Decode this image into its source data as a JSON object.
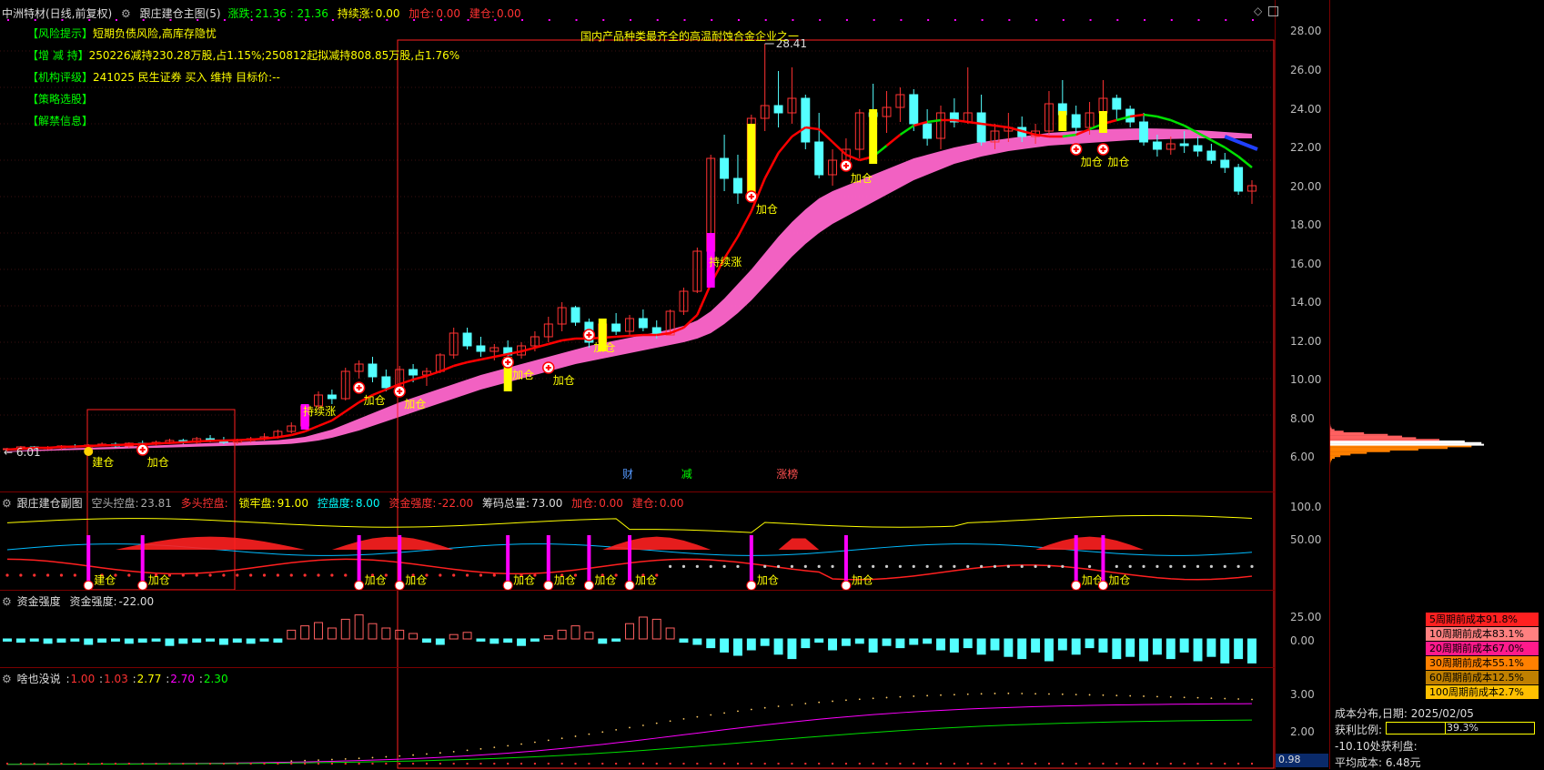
{
  "main_header": {
    "stock": "中洲特材(日线,前复权)",
    "indicator": "跟庄建仓主图(5)",
    "zd_label": "涨跌:",
    "zd_value": "21.36 : 21.36",
    "cx_label": "持续涨:",
    "cx_value": "0.00",
    "jc_label": "加仓:",
    "jc_value": "0.00",
    "jianc_label": "建仓:",
    "jianc_value": "0.00"
  },
  "info_lines": [
    {
      "key": "【风险提示】",
      "text": "短期负债风险,高库存隐忧"
    },
    {
      "key": "【增 减 持】",
      "text": "250226减持230.28万股,占1.15%;250812起拟减持808.85万股,占1.76%"
    },
    {
      "key": "【机构评级】",
      "text": "241025 民生证券 买入 维持 目标价:--"
    },
    {
      "key": "【策略选股】",
      "text": ""
    },
    {
      "key": "【解禁信息】",
      "text": ""
    }
  ],
  "banner_text": "国内产品种类最齐全的高温耐蚀合金企业之一",
  "marker_max": "28.41",
  "marker_min": "6.01",
  "event_tags": [
    "财",
    "减",
    "涨榜"
  ],
  "sub1_header": {
    "name": "跟庄建仓副图",
    "a_label": "空头控盘:",
    "a_value": "23.81",
    "b_label": "多头控盘:",
    "b_value": "",
    "c_label": "锁牢盘:",
    "c_value": "91.00",
    "d_label": "控盘度:",
    "d_value": "8.00",
    "e_label": "资金强度:",
    "e_value": "-22.00",
    "f_label": "筹码总量:",
    "f_value": "73.00",
    "g_label": "加仓:",
    "g_value": "0.00",
    "h_label": "建仓:",
    "h_value": "0.00"
  },
  "sub2_header": {
    "name": "资金强度",
    "label": "资金强度:",
    "value": "-22.00"
  },
  "sub3_header": {
    "name": "啥也没说",
    "v1": "1.00",
    "v2": "1.03",
    "v3": "2.77",
    "v4": "2.70",
    "v5": "2.30"
  },
  "axis_labels": {
    "main": [
      "28.00",
      "26.00",
      "24.00",
      "22.00",
      "20.00",
      "18.00",
      "16.00",
      "14.00",
      "12.00",
      "10.00",
      "8.00",
      "6.00"
    ],
    "sub1": [
      "100.0",
      "50.00"
    ],
    "sub2": [
      "25.00",
      "0.00"
    ],
    "sub3": [
      "3.00",
      "2.00"
    ],
    "bottom_value": "0.98"
  },
  "labels": {
    "jiacang": "加仓",
    "jiancang": "建仓",
    "chixu": "持续涨"
  },
  "cost_legend": [
    {
      "text": "5周期前成本91.8%",
      "color": "#ff2020"
    },
    {
      "text": "10周期前成本83.1%",
      "color": "#ff8080"
    },
    {
      "text": "20周期前成本67.0%",
      "color": "#ff1a8c"
    },
    {
      "text": "30周期前成本55.1%",
      "color": "#ff8000"
    },
    {
      "text": "60周期前成本12.5%",
      "color": "#c08000"
    },
    {
      "text": "100周期前成本2.7%",
      "color": "#ffc000"
    }
  ],
  "cost_info": {
    "date_label": "成本分布,日期:",
    "date": "2025/02/05",
    "profit_label": "获利比例:",
    "profit": "39.3%",
    "profit_ratio": 0.393,
    "pct_label": "-10.10处获利盘:",
    "avg_label": "平均成本:",
    "avg": "6.48元"
  },
  "colors": {
    "up": "#ff3232",
    "down": "#54ffff",
    "ma": "#ff0000",
    "ma_up": "#00e000",
    "band": "#ff66cc",
    "marker": "#ffff00"
  },
  "chart_data": {
    "type": "candlestick",
    "ylim": [
      5.0,
      29.0
    ],
    "candles": [
      [
        6.1,
        6.2,
        6.0,
        6.15
      ],
      [
        6.15,
        6.3,
        6.1,
        6.25
      ],
      [
        6.25,
        6.3,
        6.1,
        6.15
      ],
      [
        6.15,
        6.3,
        6.1,
        6.2
      ],
      [
        6.2,
        6.35,
        6.1,
        6.3
      ],
      [
        6.3,
        6.4,
        6.2,
        6.25
      ],
      [
        6.25,
        6.4,
        6.2,
        6.35
      ],
      [
        6.35,
        6.5,
        6.3,
        6.4
      ],
      [
        6.4,
        6.5,
        6.2,
        6.3
      ],
      [
        6.3,
        6.5,
        6.2,
        6.45
      ],
      [
        6.45,
        6.6,
        6.3,
        6.4
      ],
      [
        6.4,
        6.6,
        6.3,
        6.5
      ],
      [
        6.5,
        6.7,
        6.4,
        6.6
      ],
      [
        6.6,
        6.7,
        6.4,
        6.5
      ],
      [
        6.5,
        6.8,
        6.4,
        6.7
      ],
      [
        6.7,
        6.9,
        6.5,
        6.6
      ],
      [
        6.6,
        6.8,
        6.4,
        6.5
      ],
      [
        6.5,
        6.7,
        6.4,
        6.6
      ],
      [
        6.6,
        6.8,
        6.5,
        6.7
      ],
      [
        6.7,
        7.0,
        6.6,
        6.8
      ],
      [
        6.8,
        7.2,
        6.7,
        7.1
      ],
      [
        7.1,
        7.6,
        7.0,
        7.4
      ],
      [
        7.4,
        8.6,
        7.3,
        8.5
      ],
      [
        8.5,
        9.3,
        8.3,
        9.1
      ],
      [
        9.1,
        9.4,
        8.6,
        8.9
      ],
      [
        8.9,
        10.6,
        8.8,
        10.4
      ],
      [
        10.4,
        11.0,
        10.0,
        10.8
      ],
      [
        10.8,
        11.2,
        9.8,
        10.1
      ],
      [
        10.1,
        10.5,
        9.3,
        9.5
      ],
      [
        9.5,
        10.7,
        9.4,
        10.5
      ],
      [
        10.5,
        10.8,
        9.8,
        10.2
      ],
      [
        10.2,
        10.6,
        9.6,
        10.4
      ],
      [
        10.4,
        11.4,
        10.3,
        11.3
      ],
      [
        11.3,
        12.8,
        11.1,
        12.5
      ],
      [
        12.5,
        12.8,
        11.6,
        11.8
      ],
      [
        11.8,
        12.3,
        11.2,
        11.5
      ],
      [
        11.5,
        11.9,
        11.0,
        11.7
      ],
      [
        11.7,
        12.1,
        11.1,
        11.3
      ],
      [
        11.3,
        12.0,
        11.1,
        11.8
      ],
      [
        11.8,
        12.6,
        11.5,
        12.3
      ],
      [
        12.3,
        13.4,
        12.0,
        13.0
      ],
      [
        13.0,
        14.2,
        12.6,
        13.9
      ],
      [
        13.9,
        14.0,
        12.9,
        13.1
      ],
      [
        13.1,
        13.3,
        11.7,
        12.0
      ],
      [
        12.0,
        13.2,
        11.9,
        13.0
      ],
      [
        13.0,
        13.6,
        12.4,
        12.6
      ],
      [
        12.6,
        13.5,
        12.3,
        13.3
      ],
      [
        13.3,
        13.8,
        12.6,
        12.8
      ],
      [
        12.8,
        13.2,
        12.2,
        12.4
      ],
      [
        12.4,
        13.8,
        12.4,
        13.7
      ],
      [
        13.7,
        15.0,
        13.5,
        14.8
      ],
      [
        14.8,
        17.2,
        14.7,
        17.0
      ],
      [
        17.0,
        22.3,
        16.8,
        22.1
      ],
      [
        22.1,
        23.4,
        20.3,
        21.0
      ],
      [
        21.0,
        22.3,
        19.6,
        20.2
      ],
      [
        20.2,
        24.5,
        20.1,
        24.3
      ],
      [
        24.3,
        28.4,
        23.6,
        25.0
      ],
      [
        25.0,
        26.9,
        23.8,
        24.6
      ],
      [
        24.6,
        27.1,
        24.0,
        25.4
      ],
      [
        25.4,
        25.6,
        22.6,
        23.0
      ],
      [
        23.0,
        24.6,
        21.0,
        21.2
      ],
      [
        21.2,
        22.6,
        20.6,
        22.0
      ],
      [
        22.0,
        23.2,
        21.6,
        22.6
      ],
      [
        22.6,
        24.8,
        22.1,
        24.6
      ],
      [
        24.6,
        26.2,
        23.8,
        24.4
      ],
      [
        24.4,
        25.8,
        23.5,
        24.9
      ],
      [
        24.9,
        26.0,
        24.1,
        25.6
      ],
      [
        25.6,
        25.9,
        23.6,
        24.0
      ],
      [
        24.0,
        24.8,
        22.8,
        23.2
      ],
      [
        23.2,
        25.0,
        22.6,
        24.6
      ],
      [
        24.6,
        25.4,
        23.8,
        24.1
      ],
      [
        24.1,
        27.1,
        24.0,
        24.6
      ],
      [
        24.6,
        25.6,
        22.8,
        23.0
      ],
      [
        23.0,
        24.0,
        22.6,
        23.6
      ],
      [
        23.6,
        24.6,
        23.0,
        23.8
      ],
      [
        23.8,
        24.4,
        23.0,
        23.3
      ],
      [
        23.3,
        24.0,
        22.9,
        23.6
      ],
      [
        23.6,
        25.8,
        23.4,
        25.1
      ],
      [
        25.1,
        26.4,
        24.3,
        24.5
      ],
      [
        24.5,
        25.0,
        23.4,
        23.8
      ],
      [
        23.8,
        25.2,
        23.4,
        24.6
      ],
      [
        24.6,
        26.4,
        24.0,
        25.4
      ],
      [
        25.4,
        25.6,
        24.2,
        24.8
      ],
      [
        24.8,
        25.0,
        23.8,
        24.1
      ],
      [
        24.1,
        24.6,
        22.8,
        23.0
      ],
      [
        23.0,
        23.4,
        22.2,
        22.6
      ],
      [
        22.6,
        23.3,
        22.3,
        22.9
      ],
      [
        22.9,
        23.6,
        22.4,
        22.8
      ],
      [
        22.8,
        23.3,
        22.2,
        22.5
      ],
      [
        22.5,
        22.9,
        21.8,
        22.0
      ],
      [
        22.0,
        22.4,
        21.3,
        21.6
      ],
      [
        21.6,
        21.8,
        20.1,
        20.3
      ],
      [
        20.3,
        20.9,
        19.6,
        20.6
      ]
    ],
    "ma": [
      6.1,
      6.15,
      6.2,
      6.2,
      6.25,
      6.27,
      6.3,
      6.33,
      6.35,
      6.38,
      6.4,
      6.43,
      6.47,
      6.5,
      6.55,
      6.58,
      6.6,
      6.62,
      6.65,
      6.7,
      6.78,
      6.9,
      7.1,
      7.4,
      7.7,
      8.2,
      8.7,
      9.1,
      9.4,
      9.7,
      9.95,
      10.15,
      10.4,
      10.7,
      10.9,
      11.05,
      11.2,
      11.35,
      11.5,
      11.7,
      11.9,
      12.1,
      12.2,
      12.2,
      12.25,
      12.3,
      12.35,
      12.4,
      12.4,
      12.5,
      12.8,
      13.5,
      15.2,
      16.6,
      17.8,
      19.2,
      21.0,
      22.4,
      23.3,
      23.8,
      23.7,
      23.0,
      22.3,
      22.0,
      22.2,
      22.8,
      23.4,
      23.9,
      24.1,
      24.2,
      24.2,
      24.1,
      24.0,
      23.9,
      23.8,
      23.6,
      23.4,
      23.3,
      23.3,
      23.4,
      23.7,
      24.0,
      24.2,
      24.4,
      24.5,
      24.4,
      24.2,
      23.9,
      23.5,
      23.1,
      22.7,
      22.2,
      21.6
    ],
    "band_upper": [
      6.0,
      6.05,
      6.1,
      6.1,
      6.15,
      6.18,
      6.2,
      6.23,
      6.25,
      6.28,
      6.3,
      6.33,
      6.36,
      6.4,
      6.43,
      6.46,
      6.5,
      6.52,
      6.55,
      6.58,
      6.62,
      6.7,
      6.8,
      7.0,
      7.2,
      7.5,
      7.8,
      8.1,
      8.4,
      8.7,
      8.95,
      9.2,
      9.45,
      9.7,
      9.95,
      10.2,
      10.4,
      10.6,
      10.8,
      11.0,
      11.2,
      11.4,
      11.6,
      11.8,
      11.95,
      12.1,
      12.25,
      12.4,
      12.55,
      12.7,
      12.9,
      13.2,
      13.7,
      14.4,
      15.2,
      16.0,
      16.9,
      17.8,
      18.6,
      19.3,
      19.9,
      20.3,
      20.6,
      20.9,
      21.2,
      21.5,
      21.8,
      22.1,
      22.3,
      22.5,
      22.7,
      22.85,
      23.0,
      23.1,
      23.2,
      23.3,
      23.4,
      23.5,
      23.55,
      23.6,
      23.65,
      23.7,
      23.72,
      23.74,
      23.75,
      23.74,
      23.72,
      23.7,
      23.65,
      23.6,
      23.55,
      23.5,
      23.45
    ],
    "band_lower": [
      5.95,
      6.0,
      6.02,
      6.04,
      6.06,
      6.08,
      6.1,
      6.12,
      6.14,
      6.16,
      6.18,
      6.2,
      6.22,
      6.24,
      6.26,
      6.28,
      6.3,
      6.32,
      6.34,
      6.36,
      6.38,
      6.42,
      6.5,
      6.6,
      6.75,
      6.95,
      7.15,
      7.4,
      7.65,
      7.9,
      8.15,
      8.4,
      8.65,
      8.9,
      9.15,
      9.4,
      9.6,
      9.8,
      10.0,
      10.2,
      10.4,
      10.6,
      10.8,
      10.95,
      11.1,
      11.25,
      11.4,
      11.55,
      11.7,
      11.85,
      12.0,
      12.2,
      12.5,
      13.0,
      13.6,
      14.3,
      15.1,
      15.9,
      16.7,
      17.4,
      18.0,
      18.5,
      18.9,
      19.3,
      19.7,
      20.1,
      20.5,
      20.9,
      21.2,
      21.5,
      21.8,
      22.0,
      22.2,
      22.35,
      22.5,
      22.6,
      22.7,
      22.8,
      22.85,
      22.9,
      22.95,
      23.0,
      23.05,
      23.1,
      23.12,
      23.14,
      23.16,
      23.18,
      23.2,
      23.2,
      23.2,
      23.2,
      23.2
    ],
    "fund_strength": [
      -2,
      -3,
      -2,
      -4,
      -3,
      -2,
      -5,
      -3,
      -2,
      -4,
      -3,
      -2,
      -6,
      -4,
      -3,
      -2,
      -5,
      -3,
      -4,
      -2,
      -3,
      8,
      12,
      15,
      10,
      18,
      22,
      14,
      10,
      8,
      5,
      -3,
      -5,
      4,
      6,
      -2,
      -4,
      -3,
      -6,
      -2,
      3,
      8,
      12,
      6,
      -4,
      -2,
      14,
      20,
      18,
      10,
      -3,
      -5,
      -8,
      -12,
      -15,
      -10,
      -6,
      -14,
      -18,
      -8,
      -3,
      -10,
      -6,
      -4,
      -12,
      -6,
      -8,
      -5,
      -4,
      -10,
      -12,
      -8,
      -14,
      -10,
      -16,
      -18,
      -12,
      -20,
      -10,
      -14,
      -8,
      -12,
      -18,
      -16,
      -20,
      -14,
      -18,
      -12,
      -20,
      -16,
      -22,
      -18,
      -22
    ]
  }
}
